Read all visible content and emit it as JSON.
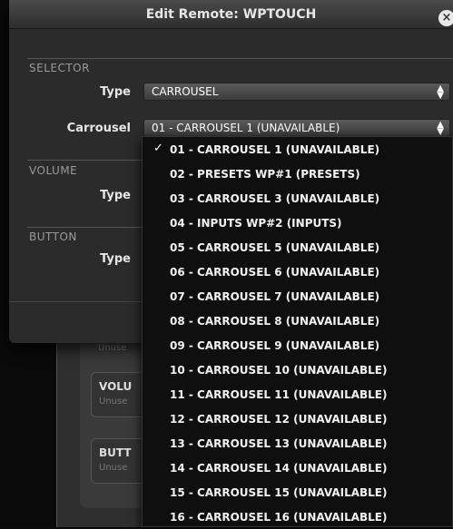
{
  "dialog": {
    "title": "Edit Remote: WPTOUCH",
    "close_symbol": "×",
    "selector": {
      "section_label": "SELECTOR",
      "type_label": "Type",
      "type_value": "CARROUSEL",
      "carrousel_label": "Carrousel",
      "carrousel_value": "01 - CARROUSEL 1 (UNAVAILABLE)"
    },
    "volume": {
      "section_label": "VOLUME",
      "type_label": "Type"
    },
    "button": {
      "section_label": "BUTTON",
      "type_label": "Type"
    }
  },
  "background": {
    "unused_top": "Unuse",
    "volume_title": "VOLU",
    "volume_sub": "Unuse",
    "button_title": "BUTT",
    "button_sub": "Unuse"
  },
  "dropdown": {
    "check_symbol": "✓",
    "selected_index": 0,
    "items": [
      "01 - CARROUSEL 1 (UNAVAILABLE)",
      "02 - PRESETS WP#1 (PRESETS)",
      "03 - CARROUSEL 3 (UNAVAILABLE)",
      "04 - INPUTS WP#2 (INPUTS)",
      "05 - CARROUSEL 5 (UNAVAILABLE)",
      "06 - CARROUSEL 6 (UNAVAILABLE)",
      "07 - CARROUSEL 7 (UNAVAILABLE)",
      "08 - CARROUSEL 8 (UNAVAILABLE)",
      "09 - CARROUSEL 9 (UNAVAILABLE)",
      "10 - CARROUSEL 10 (UNAVAILABLE)",
      "11 - CARROUSEL 11 (UNAVAILABLE)",
      "12 - CARROUSEL 12 (UNAVAILABLE)",
      "13 - CARROUSEL 13 (UNAVAILABLE)",
      "14 - CARROUSEL 14 (UNAVAILABLE)",
      "15 - CARROUSEL 15 (UNAVAILABLE)",
      "16 - CARROUSEL 16 (UNAVAILABLE)"
    ]
  }
}
